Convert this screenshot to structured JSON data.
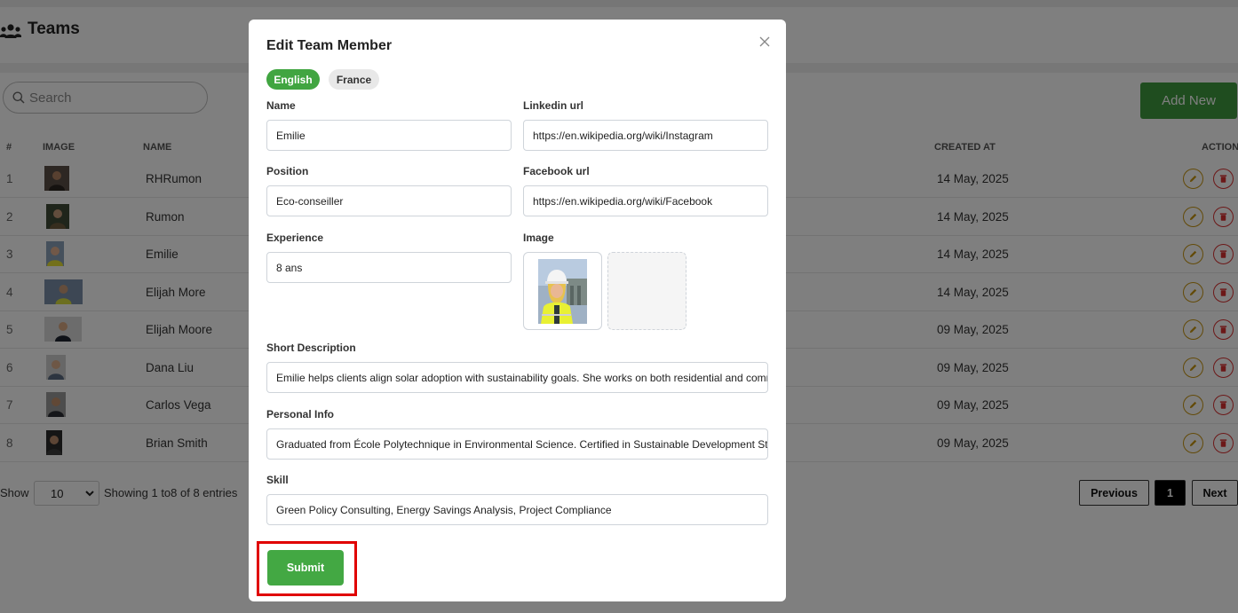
{
  "page": {
    "title": "Teams",
    "search": {
      "placeholder": "Search"
    },
    "add_new_label": "Add New",
    "table": {
      "columns": [
        "#",
        "IMAGE",
        "NAME",
        "CREATED AT",
        "ACTION"
      ],
      "rows": [
        {
          "idx": "1",
          "name": "RHRumon",
          "created": "14 May, 2025"
        },
        {
          "idx": "2",
          "name": "Rumon",
          "created": "14 May, 2025"
        },
        {
          "idx": "3",
          "name": "Emilie",
          "created": "14 May, 2025"
        },
        {
          "idx": "4",
          "name": "Elijah More",
          "created": "14 May, 2025"
        },
        {
          "idx": "5",
          "name": "Elijah Moore",
          "created": "09 May, 2025"
        },
        {
          "idx": "6",
          "name": "Dana Liu",
          "created": "09 May, 2025"
        },
        {
          "idx": "7",
          "name": "Carlos Vega",
          "created": "09 May, 2025"
        },
        {
          "idx": "8",
          "name": "Brian Smith",
          "created": "09 May, 2025"
        }
      ]
    },
    "footer": {
      "show_label": "Show",
      "page_size": "10",
      "entries_text": "Showing 1  to8  of 8 entries",
      "previous_label": "Previous",
      "current_page": "1",
      "next_label": "Next"
    }
  },
  "modal": {
    "title": "Edit Team Member",
    "tabs": [
      {
        "label": "English",
        "active": true
      },
      {
        "label": "France",
        "active": false
      }
    ],
    "fields": {
      "name": {
        "label": "Name",
        "value": "Emilie"
      },
      "linkedin": {
        "label": "Linkedin url",
        "value": "https://en.wikipedia.org/wiki/Instagram"
      },
      "position": {
        "label": "Position",
        "value": "Eco-conseiller"
      },
      "facebook": {
        "label": "Facebook url",
        "value": "https://en.wikipedia.org/wiki/Facebook"
      },
      "experience": {
        "label": "Experience",
        "value": "8 ans"
      },
      "image": {
        "label": "Image"
      },
      "short_description": {
        "label": "Short Description",
        "value": "Emilie helps clients align solar adoption with sustainability goals. She works on both residential and commercial projects."
      },
      "personal_info": {
        "label": "Personal Info",
        "value": "Graduated from École Polytechnique in Environmental Science. Certified in Sustainable Development Strategy."
      },
      "skill": {
        "label": "Skill",
        "value": "Green Policy Consulting, Energy Savings Analysis, Project Compliance"
      }
    },
    "submit_label": "Submit"
  },
  "colors": {
    "primary_green": "#43a843",
    "edit_icon": "#c69410",
    "delete_icon": "#d83030",
    "highlight": "#e00000"
  }
}
